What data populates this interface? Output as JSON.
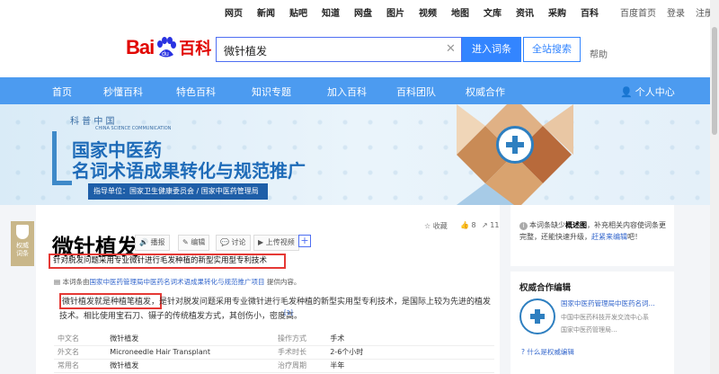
{
  "topnav": {
    "links": [
      "网页",
      "新闻",
      "贴吧",
      "知道",
      "网盘",
      "图片",
      "视频",
      "地图",
      "文库",
      "资讯",
      "采购",
      "百科"
    ],
    "right": [
      "百度首页",
      "登录",
      "注册"
    ]
  },
  "logo": {
    "bai": "Bai",
    "du": "du",
    "baike": "百科"
  },
  "search": {
    "value": "微针植发",
    "enter_label": "进入词条",
    "search_label": "全站搜索",
    "help": "帮助"
  },
  "menu": {
    "items": [
      "首页",
      "秒懂百科",
      "特色百科",
      "知识专题",
      "加入百科",
      "百科团队",
      "权威合作"
    ],
    "personal": "个人中心"
  },
  "banner": {
    "kepu": "科 普 中 国",
    "kepu_sub": "CHINA SCIENCE COMMUNICATION",
    "title1": "国家中医药",
    "title2": "名词术语成果转化与规范推广",
    "guide": "指导单位：国家卫生健康委员会 / 国家中医药管理局"
  },
  "side_badge": {
    "label": "权威\n词条"
  },
  "lemma": {
    "title": "微针植发",
    "tools": [
      "播报",
      "编辑",
      "讨论",
      "上传视频"
    ],
    "stats": {
      "collect": "收藏",
      "likes": "8",
      "shares": "11"
    },
    "summary": "针对脱发问题采用专业微针进行毛发种植的新型实用型专利技术",
    "source_prefix": "本词条由",
    "source_link": "国家中医药管理局中医药名词术语成果转化与规范推广项目",
    "source_suffix": " 提供内容。",
    "para_highlight": "微针植发就是种植笔植发",
    "para_rest": "，是针对脱发问题采用专业微针进行毛发种植的新型实用型专利技术，是国际上较为先进的植发技术。相比使用宝石刀、镊子的传统植发方式，其创伤小，密度高。",
    "cite": "[1]",
    "info": [
      {
        "k1": "中文名",
        "v1": "微针植发",
        "k2": "操作方式",
        "v2": "手术"
      },
      {
        "k1": "外文名",
        "v1": "Microneedle Hair Transplant",
        "k2": "手术时长",
        "v2": "2-6个小时"
      },
      {
        "k1": "常用名",
        "v1": "微针植发",
        "k2": "治疗周期",
        "v2": "半年"
      }
    ]
  },
  "right": {
    "notice_pre": "本词条缺少",
    "notice_bold": "概述图",
    "notice_mid": "，补充相关内容使词条更完整，还能快速升级，",
    "notice_link": "赶紧来编辑",
    "notice_end": "吧！",
    "coop_header": "权威合作编辑",
    "coop_org": "国家中医药管理局中医药名词...",
    "coop_sub1": "中国中医药科技开发交流中心系",
    "coop_sub2": "国家中医药管理局...",
    "what_link": "什么是权威编辑"
  }
}
